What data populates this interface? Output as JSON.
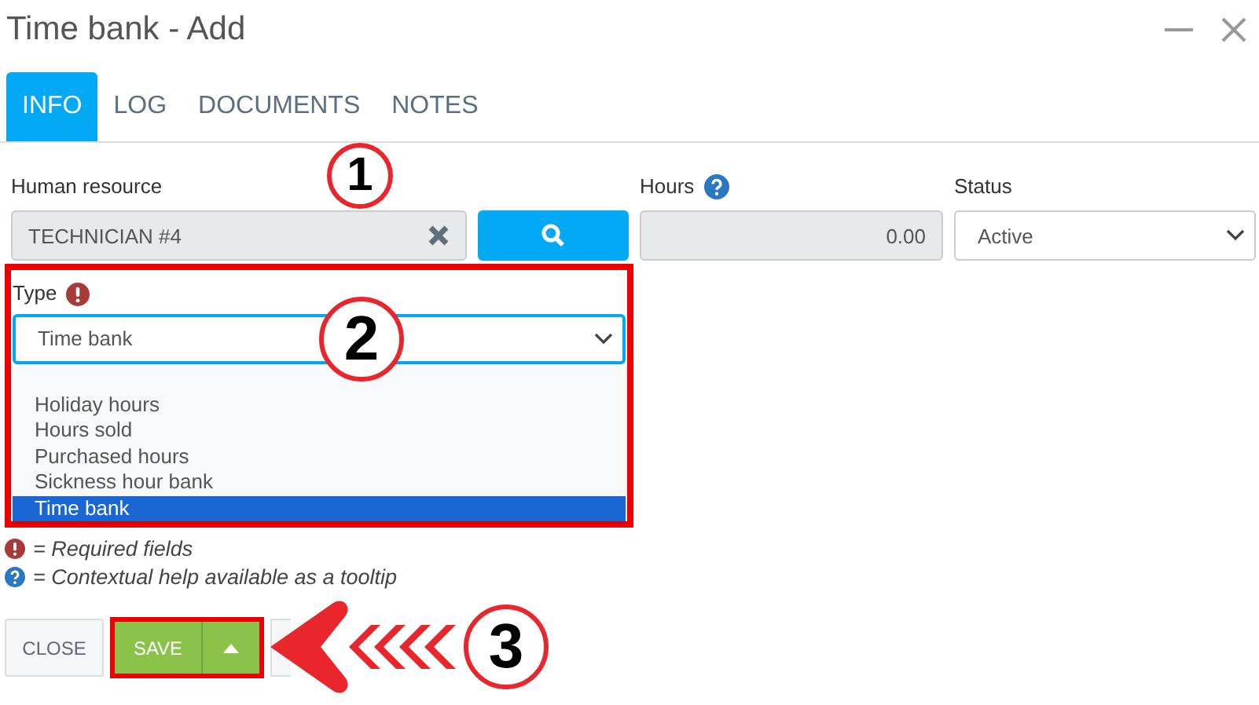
{
  "window": {
    "title": "Time bank - Add"
  },
  "tabs": [
    {
      "label": "INFO",
      "selected": true
    },
    {
      "label": "LOG",
      "selected": false
    },
    {
      "label": "DOCUMENTS",
      "selected": false
    },
    {
      "label": "NOTES",
      "selected": false
    }
  ],
  "fields": {
    "human_resource": {
      "label": "Human resource",
      "value": "TECHNICIAN #4"
    },
    "hours": {
      "label": "Hours",
      "value": "0.00"
    },
    "status": {
      "label": "Status",
      "value": "Active"
    },
    "type": {
      "label": "Type",
      "value": "Time bank",
      "options": [
        {
          "label": "Holiday hours",
          "selected": false
        },
        {
          "label": "Hours sold",
          "selected": false
        },
        {
          "label": "Purchased hours",
          "selected": false
        },
        {
          "label": "Sickness hour bank",
          "selected": false
        },
        {
          "label": "Time bank",
          "selected": true
        }
      ]
    }
  },
  "legend": [
    {
      "kind": "required",
      "text": "= Required fields"
    },
    {
      "kind": "help",
      "text": "= Contextual help available as a tooltip"
    }
  ],
  "buttons": {
    "close": "CLOSE",
    "save": "SAVE"
  },
  "callouts": [
    "1",
    "2",
    "3"
  ]
}
